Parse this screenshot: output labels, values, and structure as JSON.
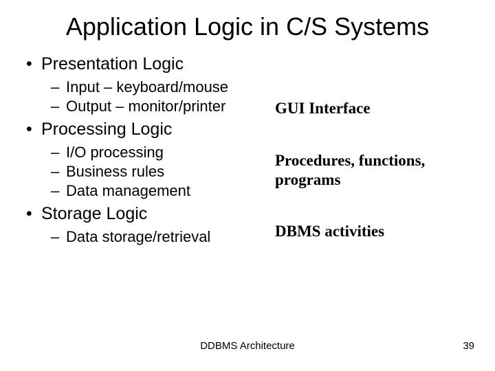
{
  "title": "Application Logic in C/S Systems",
  "sections": [
    {
      "heading": "Presentation Logic",
      "items": [
        "Input – keyboard/mouse",
        "Output – monitor/printer"
      ]
    },
    {
      "heading": "Processing Logic",
      "items": [
        "I/O processing",
        "Business rules",
        "Data management"
      ]
    },
    {
      "heading": "Storage Logic",
      "items": [
        "Data storage/retrieval"
      ]
    }
  ],
  "annotations": [
    "GUI Interface",
    "Procedures, functions, programs",
    "DBMS activities"
  ],
  "footer": "DDBMS Architecture",
  "page_number": "39"
}
